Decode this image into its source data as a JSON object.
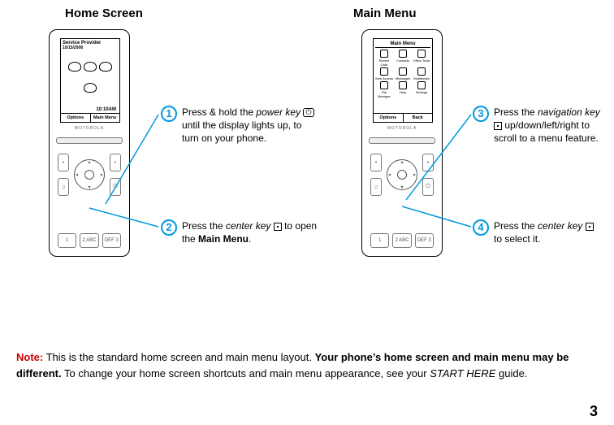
{
  "titles": {
    "left": "Home Screen",
    "right": "Main Menu"
  },
  "home_screen": {
    "service_provider": "Service Provider",
    "date": "10/15/2008",
    "time": "10:10AM",
    "soft_left": "Options",
    "soft_right": "Main Menu",
    "brand": "MOTOROLA"
  },
  "main_menu": {
    "title": "Main Menu",
    "items": [
      "Recent Calls",
      "Contacts",
      "Office Tools",
      "Web Access",
      "Messages",
      "Multimedia",
      "File Manager",
      "Help",
      "Settings"
    ],
    "soft_left": "Options",
    "soft_right": "Back",
    "brand": "MOTOROLA"
  },
  "keypad": {
    "k1": "1",
    "k2": "2 ABC",
    "k3": "DEF 3"
  },
  "callouts": {
    "c1": {
      "pre": "Press & hold the ",
      "em": "power key",
      "post": " until the display lights up, to turn on your phone.",
      "glyph": "⏻"
    },
    "c2": {
      "pre": "Press the ",
      "em": "center key",
      "mid": " to open the ",
      "bold": "Main Menu",
      "post": "."
    },
    "c3": {
      "pre": "Press the ",
      "em": "navigation key",
      "post": " up/down/left/right to scroll to a menu feature."
    },
    "c4": {
      "pre": "Press the ",
      "em": "center key",
      "post": " to select it."
    }
  },
  "note": {
    "label": "Note:",
    "t1": " This is the standard home screen and main menu layout. ",
    "bold": "Your phone’s home screen and main menu may be different.",
    "t2": " To change your home screen shortcuts and main menu appearance, see your ",
    "em": "START HERE",
    "t3": " guide."
  },
  "page_number": "3"
}
